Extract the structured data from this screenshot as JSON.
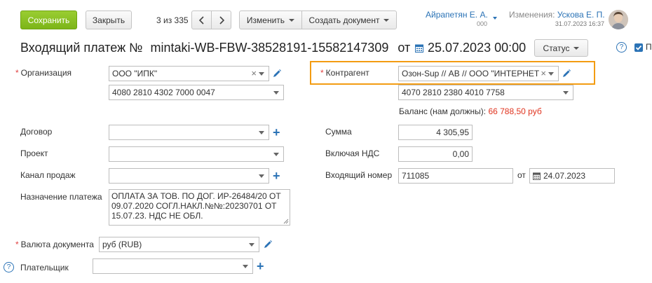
{
  "toolbar": {
    "save_label": "Сохранить",
    "close_label": "Закрыть",
    "counter": "3 из 335",
    "edit_label": "Изменить",
    "create_doc_label": "Создать документ"
  },
  "user": {
    "name": "Айрапетян Е. А.",
    "sub": "000"
  },
  "changes": {
    "label": "Изменения:",
    "by": "Ускова Е. П.",
    "date": "31.07.2023 16:37"
  },
  "doc": {
    "title": "Входящий платеж №",
    "number": "mintaki-WB-FBW-38528191-15582147309",
    "from_label": "от",
    "date": "25.07.2023 00:00",
    "status_label": "Статус"
  },
  "form": {
    "org_label": "Организация",
    "org_value": "ООО \"ИПК\"",
    "org_account": "4080 2810 4302 7000 0047",
    "contractor_label": "Контрагент",
    "contractor_value": "Озон-Sup // АВ // ООО \"ИНТЕРНЕТ",
    "contractor_account": "4070 2810 2380 4010 7758",
    "balance_label": "Баланс (нам должны):",
    "balance_value": "66 788,50 руб",
    "contract_label": "Договор",
    "project_label": "Проект",
    "channel_label": "Канал продаж",
    "purpose_label": "Назначение платежа",
    "purpose_value": "ОПЛАТА ЗА ТОВ. ПО ДОГ. ИР-26484/20 ОТ 09.07.2020 СОГЛ.НАКЛ.№№:20230701 ОТ 15.07.23. НДС НЕ ОБЛ.",
    "sum_label": "Сумма",
    "sum_value": "4 305,95",
    "vat_label": "Включая НДС",
    "vat_value": "0,00",
    "incoming_label": "Входящий номер",
    "incoming_value": "711085",
    "incoming_from": "от",
    "incoming_date": "24.07.2023",
    "currency_label": "Валюта документа",
    "currency_value": "руб (RUB)",
    "payer_label": "Плательщик"
  },
  "colors": {
    "accent": "#8dc425",
    "highlight": "#f39c12",
    "link": "#2b73b6",
    "negative": "#e0341f"
  }
}
